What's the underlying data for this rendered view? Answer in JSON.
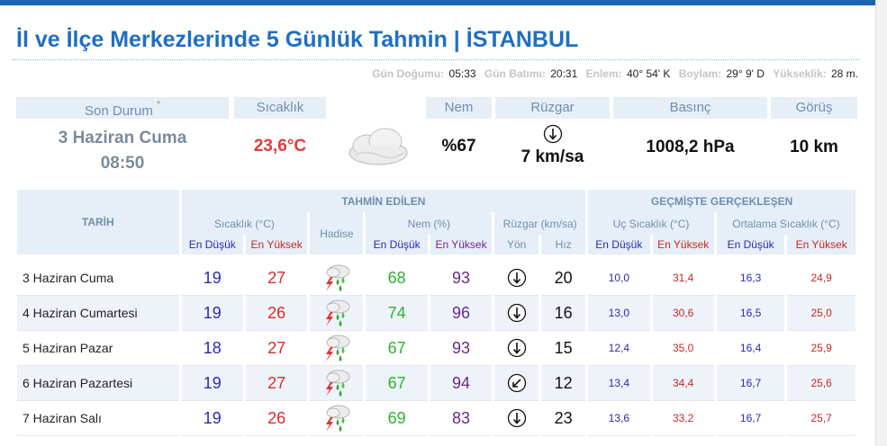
{
  "header": {
    "title_prefix": "İl ve İlçe Merkezlerinde 5 Günlük Tahmin | ",
    "city": "İSTANBUL"
  },
  "sun_info": {
    "sunrise_label": "Gün Doğumu:",
    "sunrise": "05:33",
    "sunset_label": "Gün Batımı:",
    "sunset": "20:31",
    "lat_label": "Enlem:",
    "lat": "40° 54' K",
    "lon_label": "Boylam:",
    "lon": "29° 9' D",
    "alt_label": "Yükseklik:",
    "alt": "28 m."
  },
  "current": {
    "headers": {
      "son_durum": "Son Durum",
      "asterisk": "*",
      "sicaklik": "Sıcaklık",
      "nem": "Nem",
      "ruzgar": "Rüzgar",
      "basinc": "Basınç",
      "gorus": "Görüş"
    },
    "date": "3 Haziran Cuma",
    "time": "08:50",
    "temperature": "23,6°C",
    "condition_icon": "cloud-icon",
    "humidity": "%67",
    "wind": "7 km/sa",
    "wind_direction_icon": "arrow-down-icon",
    "pressure": "1008,2 hPa",
    "visibility": "10 km"
  },
  "forecast": {
    "headers": {
      "tarih": "TARİH",
      "predicted": "TAHMİN EDİLEN",
      "observed": "GEÇMİŞTE GERÇEKLEŞEN",
      "temp": "Sıcaklık (°C)",
      "hadise": "Hadise",
      "humidity": "Nem (%)",
      "wind": "Rüzgar (km/sa)",
      "extreme_temp": "Uç Sıcaklık (°C)",
      "avg_temp": "Ortalama Sıcaklık (°C)",
      "low": "En Düşük",
      "high": "En Yüksek",
      "dir": "Yön",
      "speed": "Hız"
    },
    "days": [
      {
        "date": "3 Haziran Cuma",
        "temp_low": "19",
        "temp_high": "27",
        "event_icon": "thunderstorm-icon",
        "hum_low": "68",
        "hum_high": "93",
        "wind_dir": "arrow-down-icon",
        "wind_speed": "20",
        "ext_low": "10,0",
        "ext_high": "31,4",
        "avg_low": "16,3",
        "avg_high": "24,9"
      },
      {
        "date": "4 Haziran Cumartesi",
        "temp_low": "19",
        "temp_high": "26",
        "event_icon": "thunderstorm-icon",
        "hum_low": "74",
        "hum_high": "96",
        "wind_dir": "arrow-down-icon",
        "wind_speed": "16",
        "ext_low": "13,0",
        "ext_high": "30,6",
        "avg_low": "16,5",
        "avg_high": "25,0"
      },
      {
        "date": "5 Haziran Pazar",
        "temp_low": "18",
        "temp_high": "27",
        "event_icon": "thunderstorm-icon",
        "hum_low": "67",
        "hum_high": "93",
        "wind_dir": "arrow-down-icon",
        "wind_speed": "15",
        "ext_low": "12,4",
        "ext_high": "35,0",
        "avg_low": "16,4",
        "avg_high": "25,9"
      },
      {
        "date": "6 Haziran Pazartesi",
        "temp_low": "19",
        "temp_high": "27",
        "event_icon": "thunderstorm-icon",
        "hum_low": "67",
        "hum_high": "94",
        "wind_dir": "arrow-down-left-icon",
        "wind_speed": "12",
        "ext_low": "13,4",
        "ext_high": "34,4",
        "avg_low": "16,7",
        "avg_high": "25,6"
      },
      {
        "date": "7 Haziran Salı",
        "temp_low": "19",
        "temp_high": "26",
        "event_icon": "thunderstorm-icon",
        "hum_low": "69",
        "hum_high": "83",
        "wind_dir": "arrow-down-icon",
        "wind_speed": "23",
        "ext_low": "13,6",
        "ext_high": "33,2",
        "avg_low": "16,7",
        "avg_high": "25,7"
      }
    ]
  },
  "colors": {
    "title_blue": "#1f6fc2",
    "header_bg": "#e6eef7",
    "header_text": "#6e8fae",
    "temp_low": "#2a2ab0",
    "temp_high": "#dd2a2a",
    "humidity_low": "#2bb52b",
    "humidity_high": "#6a2a8a"
  }
}
